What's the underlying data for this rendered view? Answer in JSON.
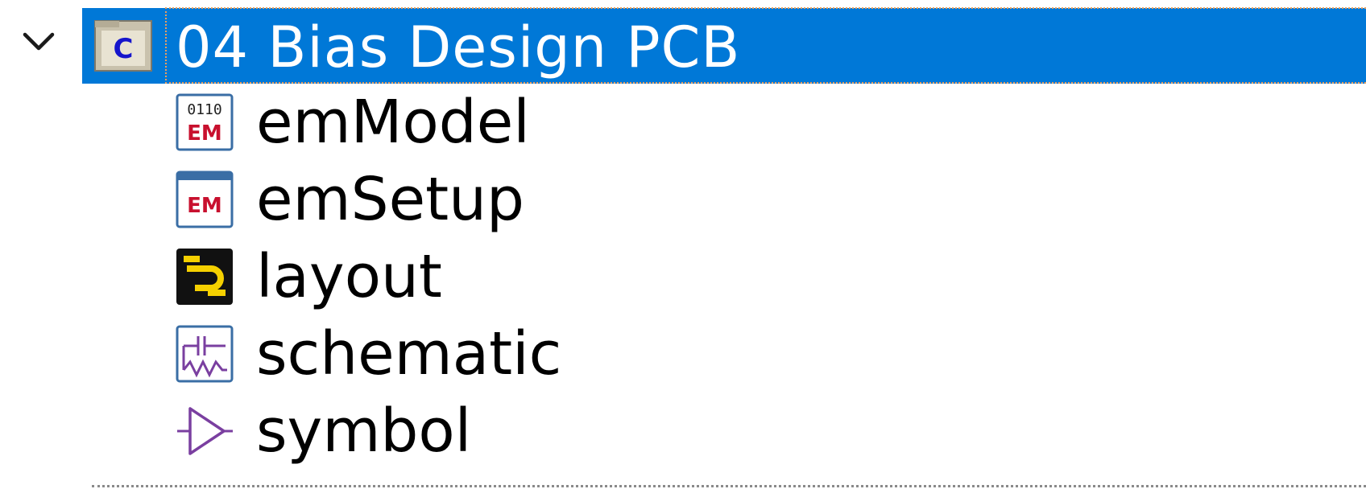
{
  "tree": {
    "root": {
      "label": "04 Bias Design PCB",
      "icon": "cell-folder-icon",
      "icon_glyph": "C",
      "expanded": true,
      "selected": true
    },
    "children": [
      {
        "label": "emModel",
        "icon": "em-model-icon",
        "icon_text_top": "0110",
        "icon_text_bottom": "EM"
      },
      {
        "label": "emSetup",
        "icon": "em-setup-icon",
        "icon_text": "EM"
      },
      {
        "label": "layout",
        "icon": "layout-icon"
      },
      {
        "label": "schematic",
        "icon": "schematic-icon"
      },
      {
        "label": "symbol",
        "icon": "symbol-icon"
      }
    ]
  },
  "colors": {
    "selection": "#0078d7",
    "em_red": "#c8102e",
    "schematic_purple": "#7a3fa0",
    "layout_yellow": "#f5d000"
  }
}
